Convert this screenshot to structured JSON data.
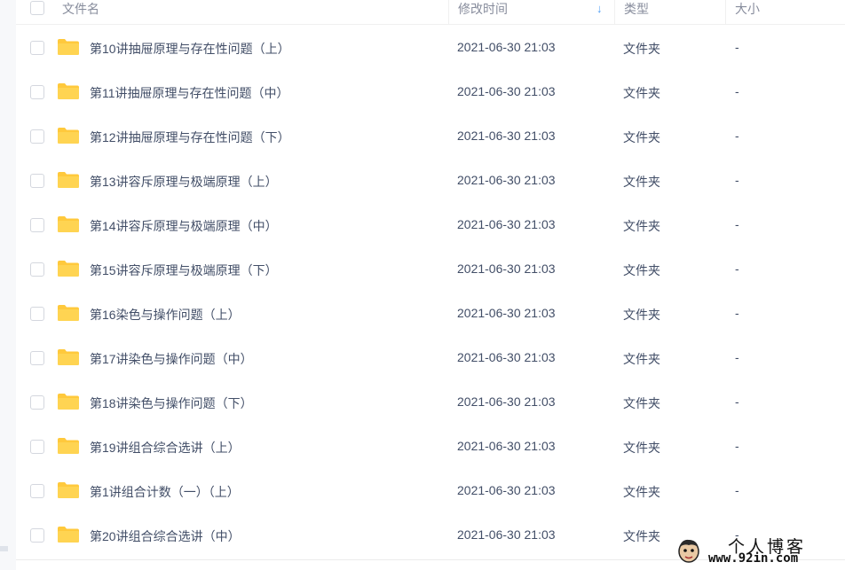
{
  "header": {
    "name_label": "文件名",
    "mtime_label": "修改时间",
    "type_label": "类型",
    "size_label": "大小",
    "sort_icon": "↓"
  },
  "rows": [
    {
      "name": "第10讲抽屉原理与存在性问题（上）",
      "mtime": "2021-06-30 21:03",
      "type": "文件夹",
      "size": "-"
    },
    {
      "name": "第11讲抽屉原理与存在性问题（中）",
      "mtime": "2021-06-30 21:03",
      "type": "文件夹",
      "size": "-"
    },
    {
      "name": "第12讲抽屉原理与存在性问题（下）",
      "mtime": "2021-06-30 21:03",
      "type": "文件夹",
      "size": "-"
    },
    {
      "name": "第13讲容斥原理与极端原理（上）",
      "mtime": "2021-06-30 21:03",
      "type": "文件夹",
      "size": "-"
    },
    {
      "name": "第14讲容斥原理与极端原理（中）",
      "mtime": "2021-06-30 21:03",
      "type": "文件夹",
      "size": "-"
    },
    {
      "name": "第15讲容斥原理与极端原理（下）",
      "mtime": "2021-06-30 21:03",
      "type": "文件夹",
      "size": "-"
    },
    {
      "name": "第16染色与操作问题（上）",
      "mtime": "2021-06-30 21:03",
      "type": "文件夹",
      "size": "-"
    },
    {
      "name": "第17讲染色与操作问题（中）",
      "mtime": "2021-06-30 21:03",
      "type": "文件夹",
      "size": "-"
    },
    {
      "name": "第18讲染色与操作问题（下）",
      "mtime": "2021-06-30 21:03",
      "type": "文件夹",
      "size": "-"
    },
    {
      "name": "第19讲组合综合选讲（上）",
      "mtime": "2021-06-30 21:03",
      "type": "文件夹",
      "size": "-"
    },
    {
      "name": "第1讲组合计数（一）（上）",
      "mtime": "2021-06-30 21:03",
      "type": "文件夹",
      "size": "-"
    },
    {
      "name": "第20讲组合综合选讲（中）",
      "mtime": "2021-06-30 21:03",
      "type": "文件夹",
      "size": "-"
    }
  ],
  "watermark": {
    "title": "个人博客",
    "url": "www.92in.com"
  },
  "colors": {
    "folder": "#ffc93c",
    "accent": "#4e9ef5",
    "text": "#424e67"
  }
}
